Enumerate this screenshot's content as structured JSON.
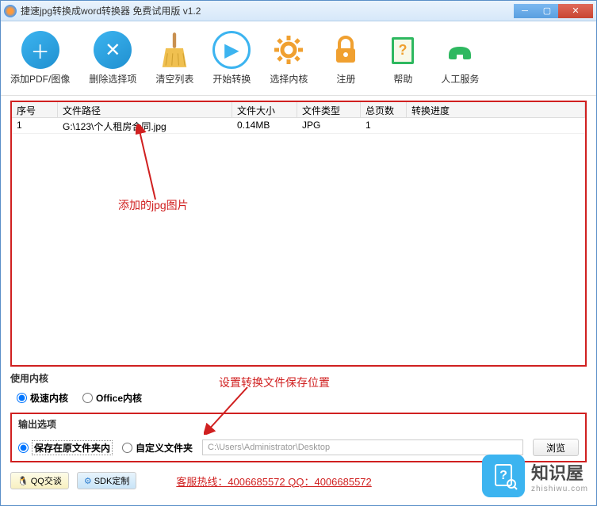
{
  "window": {
    "title": "捷速jpg转换成word转换器 免费试用版 v1.2"
  },
  "toolbar": {
    "add": "添加PDF/图像",
    "del": "删除选择项",
    "clear": "清空列表",
    "start": "开始转换",
    "core": "选择内核",
    "register": "注册",
    "help": "帮助",
    "service": "人工服务"
  },
  "columns": {
    "seq": "序号",
    "path": "文件路径",
    "size": "文件大小",
    "type": "文件类型",
    "pages": "总页数",
    "progress": "转换进度"
  },
  "rows": [
    {
      "seq": "1",
      "path": "G:\\123\\个人租房合同.jpg",
      "size": "0.14MB",
      "type": "JPG",
      "pages": "1",
      "progress": ""
    }
  ],
  "annotations": {
    "added": "添加的jpg图片",
    "save_location": "设置转换文件保存位置"
  },
  "core_section": {
    "label": "使用内核",
    "fast": "极速内核",
    "office": "Office内核"
  },
  "output_section": {
    "label": "输出选项",
    "same_folder": "保存在原文件夹内",
    "custom_folder": "自定义文件夹",
    "path": "C:\\Users\\Administrator\\Desktop",
    "browse": "浏览"
  },
  "footer": {
    "qq": "QQ交谈",
    "sdk": "SDK定制",
    "hotline": "客服热线：4006685572 QQ：4006685572"
  },
  "watermark": {
    "main": "知识屋",
    "sub": "zhishiwu.com"
  }
}
